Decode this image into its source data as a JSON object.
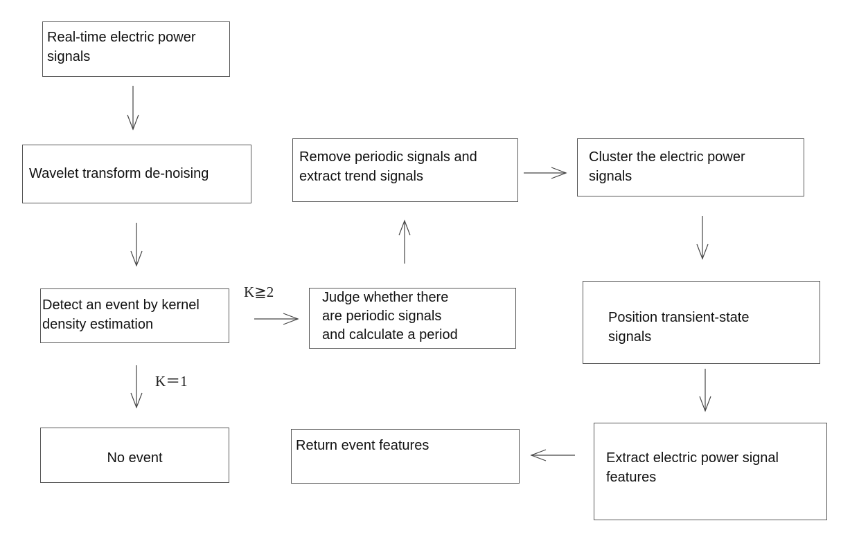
{
  "diagram": {
    "type": "flowchart",
    "nodes": {
      "realtime": "Real-time electric power\nsignals",
      "wavelet": "Wavelet transform de-noising",
      "detect": "Detect an event by kernel\ndensity estimation",
      "no_event": "No event",
      "judge": "Judge whether there\nare periodic signals\nand calculate a period",
      "remove": "Remove periodic signals and\nextract trend signals",
      "cluster": "Cluster the electric power\nsignals",
      "position": "Position transient-state\nsignals",
      "extract": "Extract electric power signal\nfeatures",
      "return": "Return event features"
    },
    "conditions": {
      "k_ge_2": "K≧2",
      "k_eq_1": "K＝1"
    },
    "edges": [
      {
        "from": "realtime",
        "to": "wavelet",
        "label": ""
      },
      {
        "from": "wavelet",
        "to": "detect",
        "label": ""
      },
      {
        "from": "detect",
        "to": "no_event",
        "label": "K＝1"
      },
      {
        "from": "detect",
        "to": "judge",
        "label": "K≧2"
      },
      {
        "from": "judge",
        "to": "remove",
        "label": ""
      },
      {
        "from": "remove",
        "to": "cluster",
        "label": ""
      },
      {
        "from": "cluster",
        "to": "position",
        "label": ""
      },
      {
        "from": "position",
        "to": "extract",
        "label": ""
      },
      {
        "from": "extract",
        "to": "return",
        "label": ""
      }
    ]
  }
}
